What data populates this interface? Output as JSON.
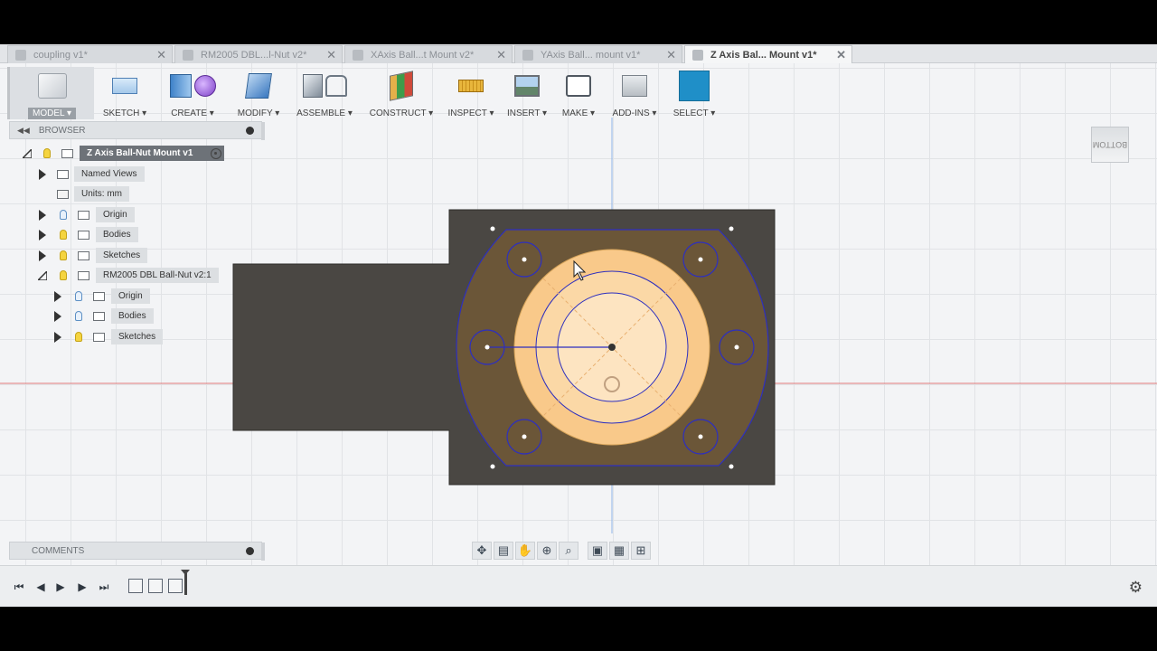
{
  "tabs": [
    {
      "label": "coupling v1*",
      "active": false
    },
    {
      "label": "RM2005 DBL...l-Nut v2*",
      "active": false
    },
    {
      "label": "XAxis Ball...t Mount v2*",
      "active": false
    },
    {
      "label": "YAxis Ball... mount v1*",
      "active": false
    },
    {
      "label": "Z Axis Bal... Mount v1*",
      "active": true
    }
  ],
  "toolbar": {
    "model": "MODEL ▾",
    "sketch": "SKETCH ▾",
    "create": "CREATE ▾",
    "modify": "MODIFY ▾",
    "assemble": "ASSEMBLE ▾",
    "construct": "CONSTRUCT ▾",
    "inspect": "INSPECT ▾",
    "insert": "INSERT ▾",
    "make": "MAKE ▾",
    "addins": "ADD-INS ▾",
    "select": "SELECT ▾"
  },
  "viewcube": {
    "face": "BOTTOM"
  },
  "browser": {
    "title": "BROWSER",
    "root": "Z Axis Ball-Nut Mount v1",
    "named_views": "Named Views",
    "units": "Units: mm",
    "origin": "Origin",
    "bodies": "Bodies",
    "sketches": "Sketches",
    "component": "RM2005 DBL Ball-Nut v2:1",
    "sub_origin": "Origin",
    "sub_bodies": "Bodies",
    "sub_sketches": "Sketches"
  },
  "comments": {
    "title": "COMMENTS"
  },
  "colors": {
    "body_fill": "#4a4743",
    "sketch_fill": "#f9c98a",
    "sketch_line": "#2d2fbf",
    "axis_red": "#e07a7a",
    "axis_blue": "#8fb5e8"
  },
  "icons": {
    "nav": [
      "orbit-icon",
      "look-at-icon",
      "pan-icon",
      "zoom-icon",
      "zoom-window-icon",
      "display-settings-icon",
      "grid-icon",
      "viewports-icon"
    ],
    "timeline": [
      "first-icon",
      "previous-icon",
      "play-icon",
      "next-icon",
      "last-icon"
    ]
  }
}
